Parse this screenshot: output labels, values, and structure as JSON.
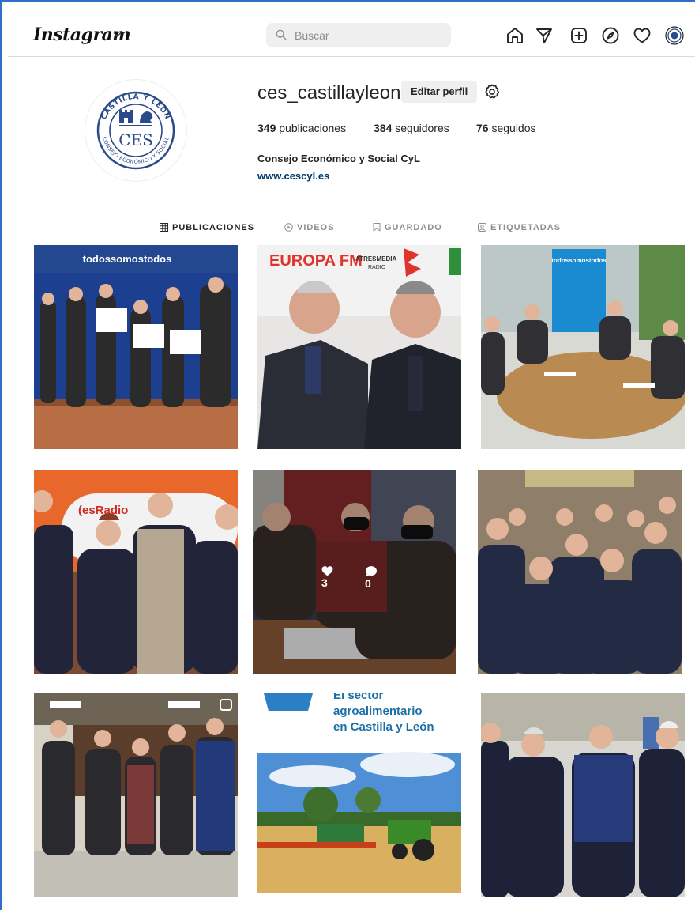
{
  "header": {
    "logo": "Instagram",
    "search_placeholder": "Buscar",
    "icons": [
      "home-icon",
      "direct-icon",
      "new-post-icon",
      "explore-icon",
      "activity-icon",
      "profile-avatar"
    ]
  },
  "profile": {
    "username": "ces_castillayleon",
    "edit_button": "Editar perfil",
    "posts_count": "349",
    "posts_label": " publicaciones",
    "followers_count": "384",
    "followers_label": " seguidores",
    "following_count": "76",
    "following_label": " seguidos",
    "full_name": "Consejo Económico y Social CyL",
    "website": "www.cescyl.es",
    "logo_text": {
      "arc_top": "CASTILLA Y LEÓN",
      "arc_bottom": "CONSEJO ECONÓMICO Y SOCIAL",
      "center": "CES"
    }
  },
  "tabs": [
    {
      "label": "PUBLICACIONES",
      "active": true
    },
    {
      "label": "VIDEOS",
      "active": false
    },
    {
      "label": "GUARDADO",
      "active": false
    },
    {
      "label": "ETIQUETADAS",
      "active": false
    }
  ],
  "posts": {
    "hover_likes": "3",
    "hover_comments": "0",
    "tile1_banner": "todossomostodos",
    "tile2_logo": "EUROPA FM",
    "tile2_brand": "ATRESMEDIA",
    "tile2_brand2": "RADIO",
    "tile3_banner": "todossomostodos",
    "tile4_brand": "(esRadio",
    "tile8_title_1": "El sector",
    "tile8_title_2": "agroalimentario",
    "tile8_title_3": "en Castilla y León"
  },
  "colors": {
    "accent_link": "#00376b",
    "tile1_banner": "#1d3f8f",
    "tile2_red": "#e0332b",
    "tile3_banner": "#1a8bd0",
    "tile4_orange": "#e8672a",
    "tile8_title": "#1a6fa8"
  }
}
